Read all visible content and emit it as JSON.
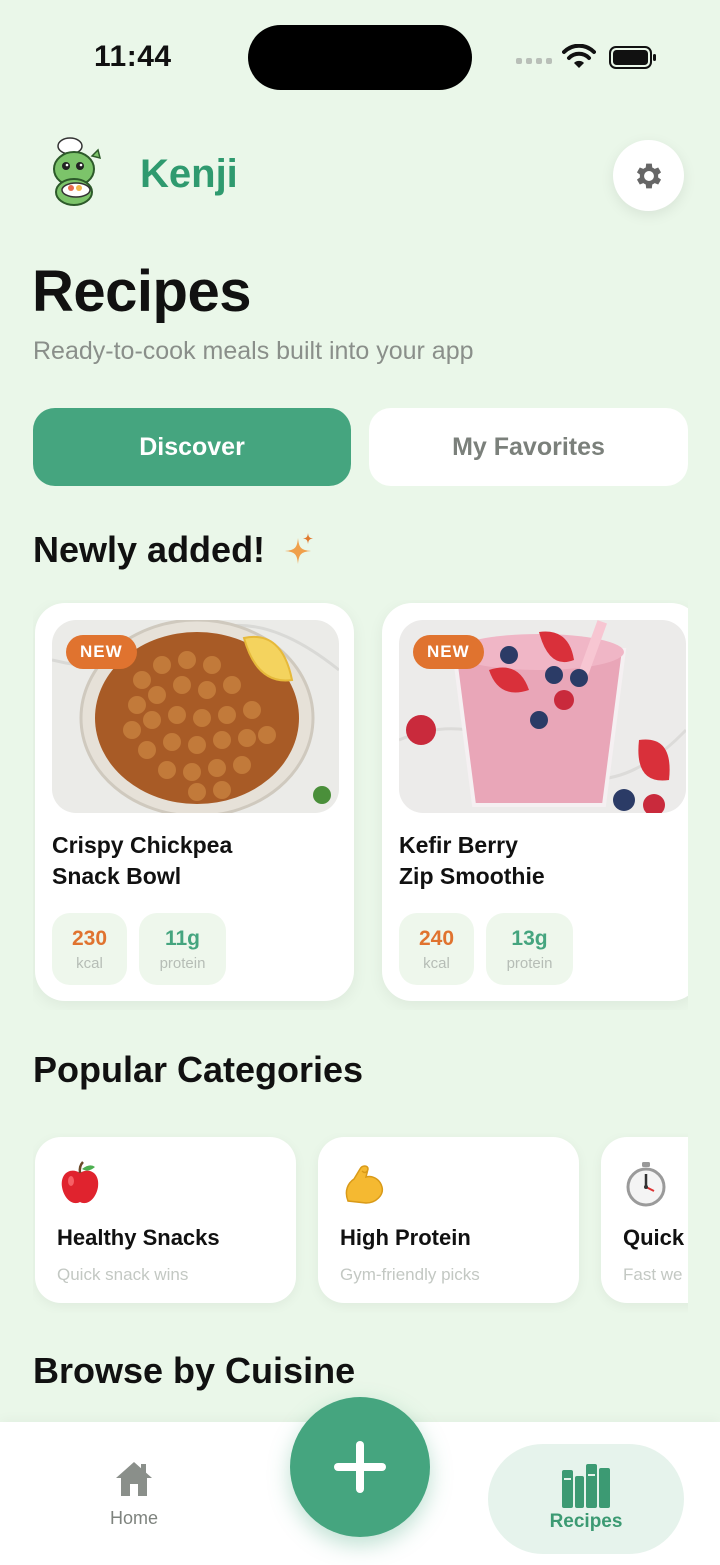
{
  "status_bar": {
    "time": "11:44"
  },
  "header": {
    "app_name": "Kenji",
    "mascot_icon": "chef-dinosaur-mascot",
    "settings_icon": "gear-icon"
  },
  "page": {
    "title": "Recipes",
    "subtitle": "Ready-to-cook meals built into your app"
  },
  "tabs": [
    {
      "label": "Discover",
      "active": true
    },
    {
      "label": "My Favorites",
      "active": false
    }
  ],
  "newly_added": {
    "title": "Newly added!",
    "icon": "sparkle-icon",
    "recipes": [
      {
        "badge": "NEW",
        "name_line1": "Crispy Chickpea",
        "name_line2": "Snack Bowl",
        "kcal": "230",
        "kcal_unit": "kcal",
        "protein": "11g",
        "protein_unit": "protein",
        "image": "roasted-chickpeas-bowl"
      },
      {
        "badge": "NEW",
        "name_line1": "Kefir Berry",
        "name_line2": "Zip Smoothie",
        "kcal": "240",
        "kcal_unit": "kcal",
        "protein": "13g",
        "protein_unit": "protein",
        "image": "berry-smoothie-glass"
      }
    ]
  },
  "popular": {
    "title": "Popular Categories",
    "categories": [
      {
        "name": "Healthy Snacks",
        "desc": "Quick snack wins",
        "icon": "apple-icon"
      },
      {
        "name": "High Protein",
        "desc": "Gym-friendly picks",
        "icon": "flexed-biceps-icon"
      },
      {
        "name": "Quick",
        "desc": "Fast we",
        "icon": "stopwatch-icon"
      }
    ]
  },
  "cuisine": {
    "title": "Browse by Cuisine"
  },
  "bottom_nav": {
    "home_label": "Home",
    "recipes_label": "Recipes",
    "add_icon": "plus-icon"
  },
  "colors": {
    "accent": "#45a57f",
    "brand_text": "#2f9a6f",
    "orange": "#e0732f",
    "background": "#eaf7e9"
  }
}
